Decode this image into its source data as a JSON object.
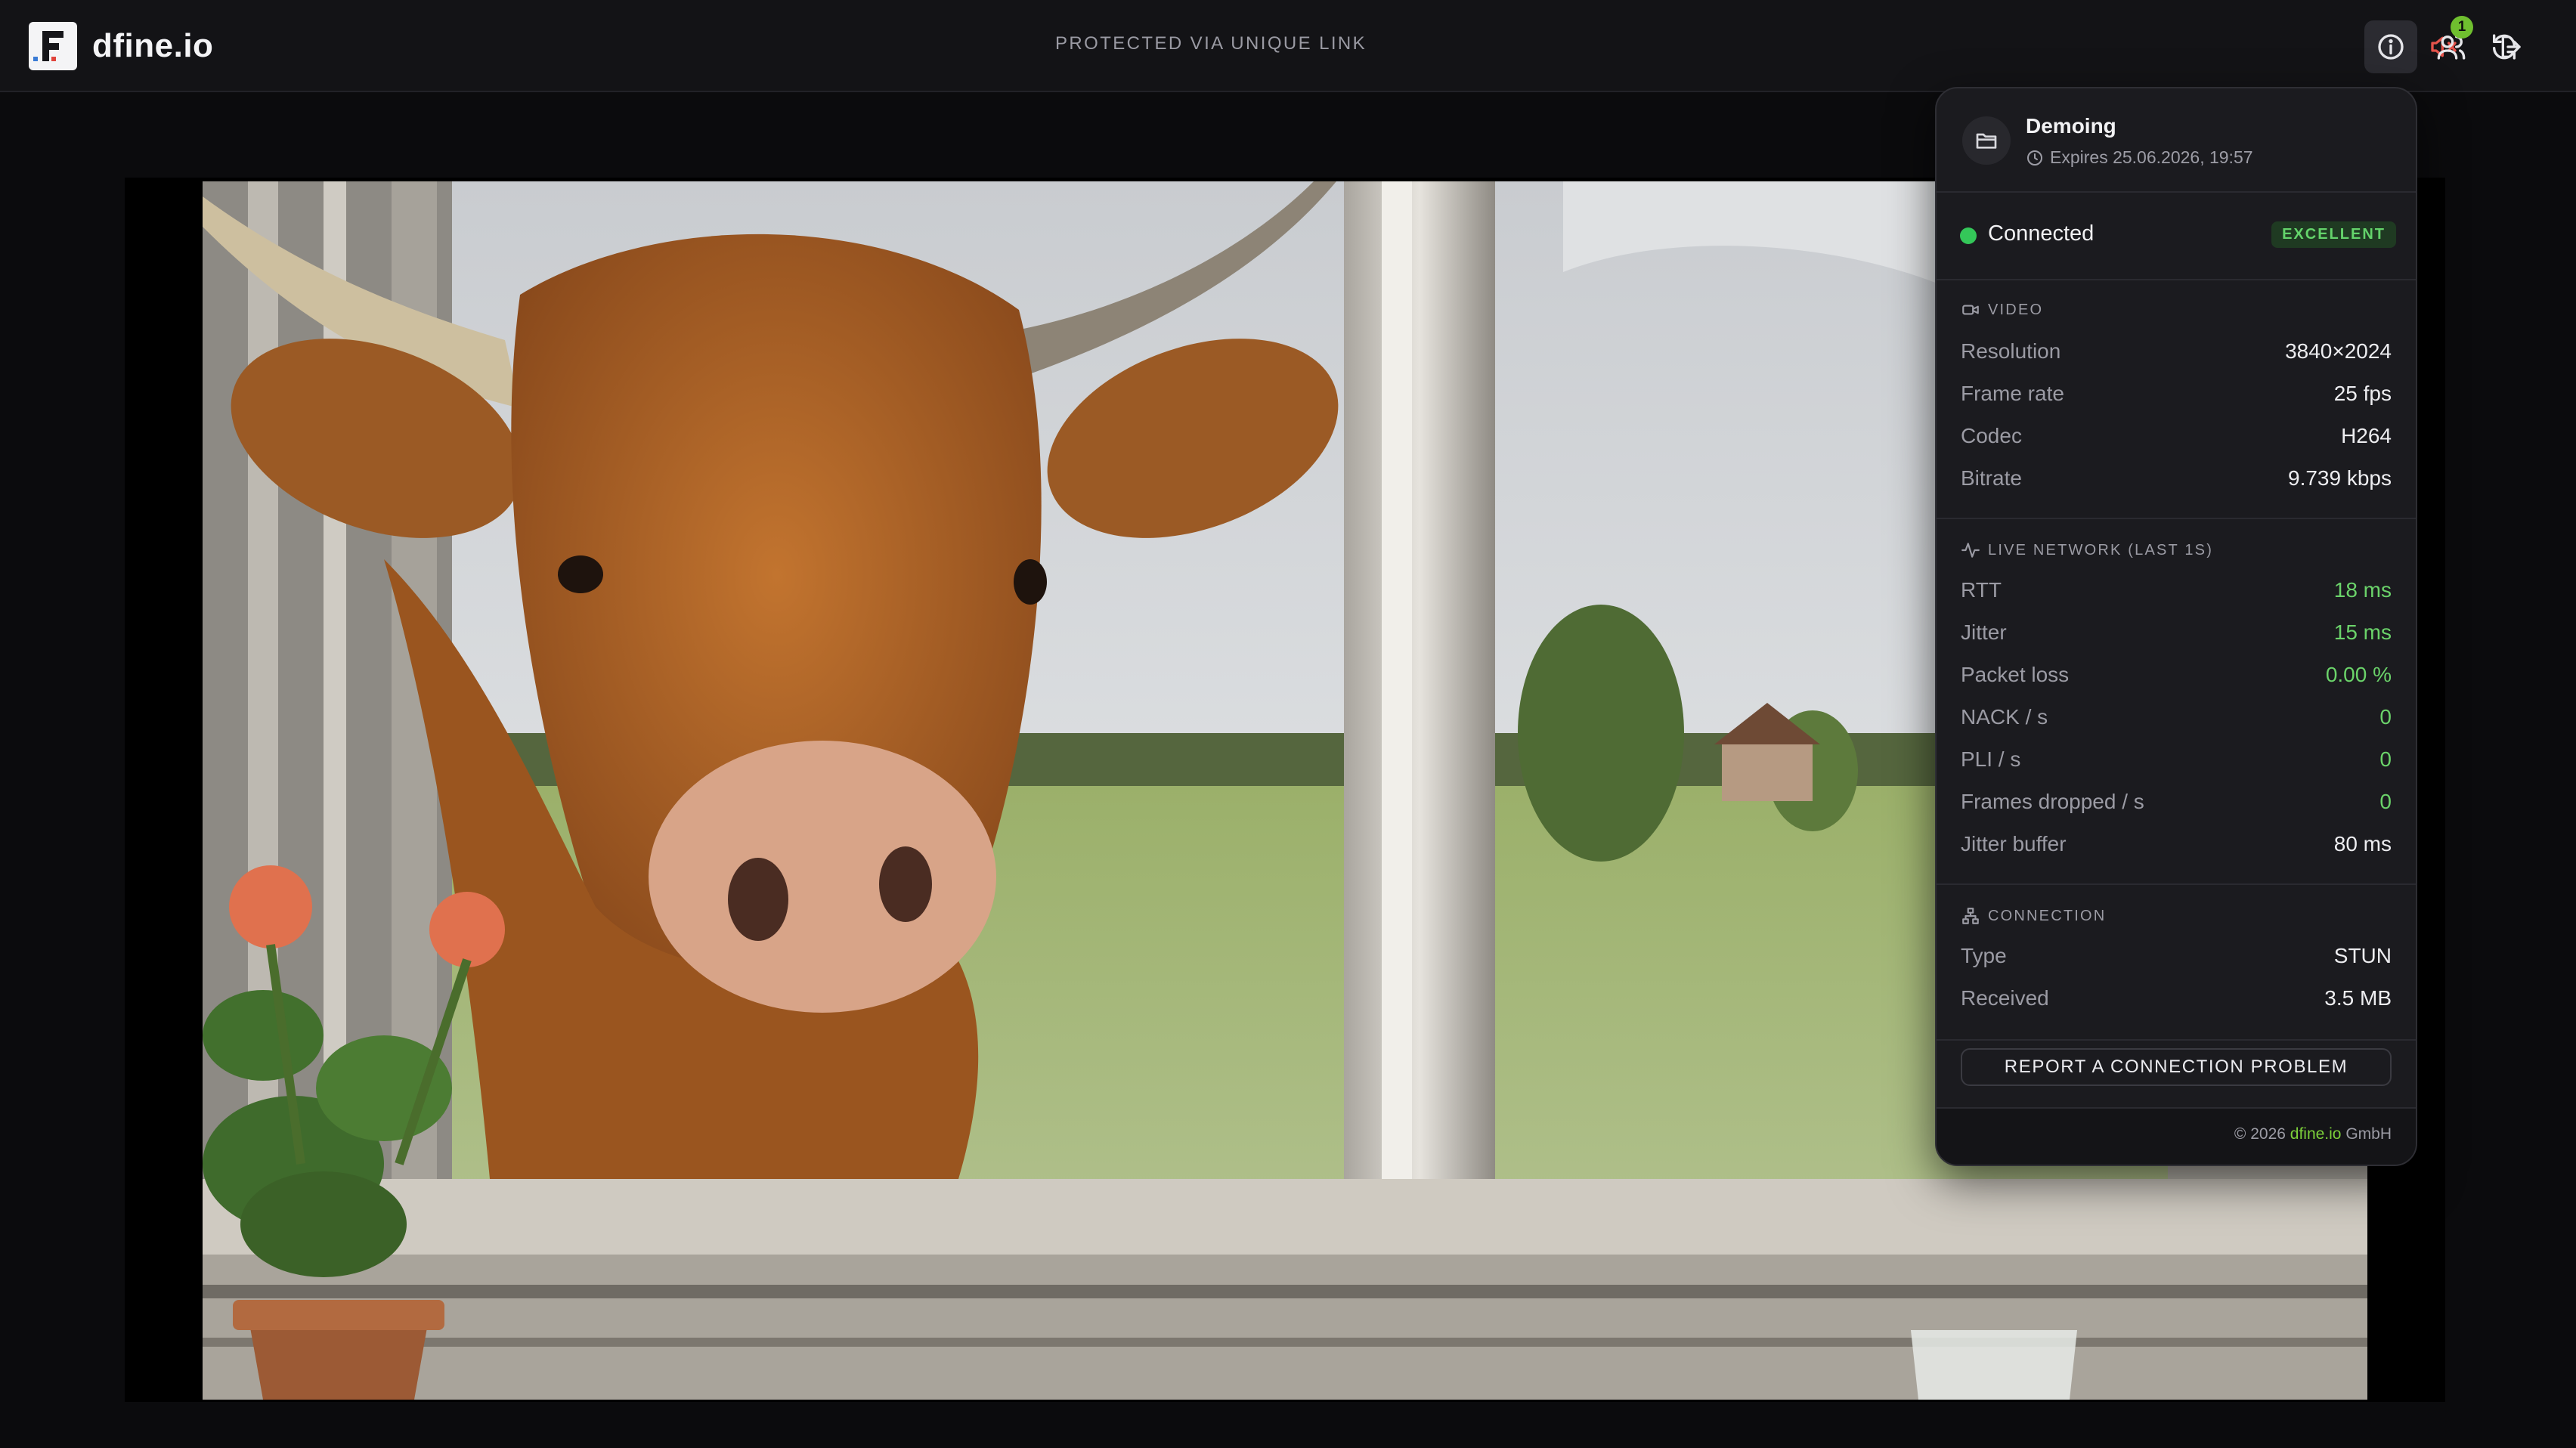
{
  "header": {
    "brand": "dfine.io",
    "protected_label": "PROTECTED VIA UNIQUE LINK",
    "toolbar": [
      {
        "name": "fullscreen-icon"
      },
      {
        "name": "mute-icon",
        "color": "#e5534b"
      },
      {
        "name": "refresh-icon"
      },
      {
        "name": "info-icon",
        "active": true
      },
      {
        "name": "participants-icon",
        "badge": "1"
      },
      {
        "name": "logout-icon"
      }
    ],
    "participants_badge": "1"
  },
  "panel": {
    "session_name": "Demoing",
    "expires": "Expires 25.06.2026, 19:57",
    "status": "Connected",
    "quality": "EXCELLENT",
    "video": {
      "title": "VIDEO",
      "rows": [
        {
          "label": "Resolution",
          "value": "3840×2024"
        },
        {
          "label": "Frame rate",
          "value": "25 fps"
        },
        {
          "label": "Codec",
          "value": "H264"
        },
        {
          "label": "Bitrate",
          "value": "9.739 kbps"
        }
      ]
    },
    "network": {
      "title": "LIVE NETWORK (LAST 1S)",
      "rows": [
        {
          "label": "RTT",
          "value": "18 ms"
        },
        {
          "label": "Jitter",
          "value": "15 ms"
        },
        {
          "label": "Packet loss",
          "value": "0.00 %"
        },
        {
          "label": "NACK / s",
          "value": "0"
        },
        {
          "label": "PLI / s",
          "value": "0"
        },
        {
          "label": "Frames dropped / s",
          "value": "0"
        },
        {
          "label": "Jitter buffer",
          "value": "80 ms"
        }
      ]
    },
    "connection": {
      "title": "CONNECTION",
      "rows": [
        {
          "label": "Type",
          "value": "STUN"
        },
        {
          "label": "Received",
          "value": "3.5 MB"
        }
      ]
    },
    "report_button": "REPORT A CONNECTION PROBLEM",
    "footer": {
      "prefix": "© 2026 ",
      "brand": "dfine.io",
      "suffix": " GmbH"
    }
  },
  "colors": {
    "good": "#6bd36a",
    "status_dot": "#34c759",
    "badge": "#6fbf2f",
    "mute": "#e5534b"
  }
}
